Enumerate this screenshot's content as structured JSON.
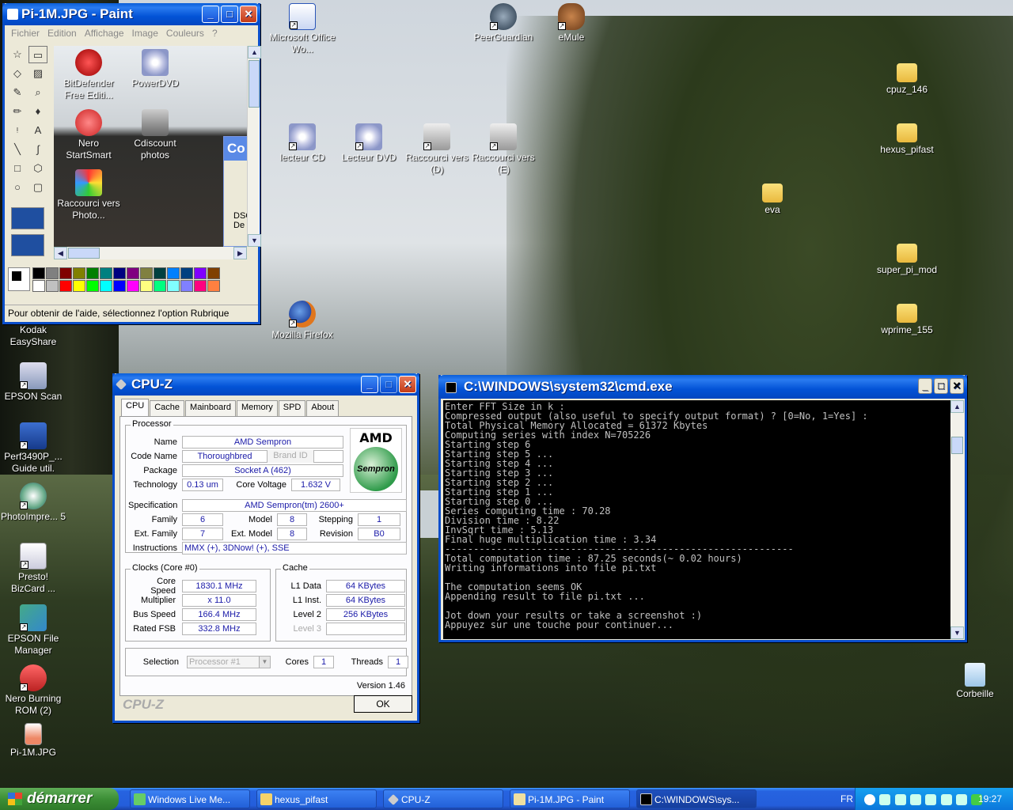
{
  "desktop": {
    "icons": [
      {
        "id": "msoffice",
        "label": "Microsoft Office Wo..."
      },
      {
        "id": "peerguardian",
        "label": "PeerGuardian"
      },
      {
        "id": "emule",
        "label": "eMule"
      },
      {
        "id": "lecteur_cd",
        "label": "lecteur CD"
      },
      {
        "id": "lecteur_dvd",
        "label": "Lecteur DVD"
      },
      {
        "id": "raccourci_d",
        "label": "Raccourci vers (D)"
      },
      {
        "id": "raccourci_e",
        "label": "Raccourci vers  (E)"
      },
      {
        "id": "cpuz146",
        "label": "cpuz_146"
      },
      {
        "id": "hexus",
        "label": "hexus_pifast"
      },
      {
        "id": "eva",
        "label": "eva"
      },
      {
        "id": "superpi",
        "label": "super_pi_mod"
      },
      {
        "id": "wprime",
        "label": "wprime_155"
      },
      {
        "id": "firefox",
        "label": "Mozilla Firefox"
      },
      {
        "id": "kodak",
        "label": "Kodak EasyShare"
      },
      {
        "id": "epsonscan",
        "label": "EPSON Scan"
      },
      {
        "id": "perf3490",
        "label": "Perf3490P_... Guide util."
      },
      {
        "id": "photoimpression",
        "label": "PhotoImpre... 5"
      },
      {
        "id": "presto",
        "label": "Presto! BizCard ..."
      },
      {
        "id": "epsonfile",
        "label": "EPSON File Manager"
      },
      {
        "id": "nero_burning",
        "label": "Nero Burning ROM (2)"
      },
      {
        "id": "pi1m",
        "label": "Pi-1M.JPG"
      },
      {
        "id": "corbeille",
        "label": "Corbeille"
      }
    ]
  },
  "paint": {
    "title": "Pi-1M.JPG - Paint",
    "menu": [
      "Fichier",
      "Edition",
      "Affichage",
      "Image",
      "Couleurs",
      "?"
    ],
    "canvas_icons": [
      {
        "label": "BitDefender Free Editi..."
      },
      {
        "label": "PowerDVD"
      },
      {
        "label": "Nero StartSmart"
      },
      {
        "label": "Cdiscount photos"
      },
      {
        "label": "Raccourci vers Photo..."
      }
    ],
    "canvas_fragment": [
      "Co",
      "DSC",
      "De"
    ],
    "tools": [
      "☆",
      "▭",
      "◇",
      "▨",
      "✎",
      "⌕",
      "✏",
      "♦",
      "ᵎ",
      "A",
      "╲",
      "∫",
      "□",
      "⬡",
      "○",
      "▢"
    ],
    "palette": [
      "#000000",
      "#808080",
      "#800000",
      "#808000",
      "#008000",
      "#008080",
      "#000080",
      "#800080",
      "#808040",
      "#004040",
      "#0080ff",
      "#004080",
      "#8000ff",
      "#804000",
      "#ffffff",
      "#c0c0c0",
      "#ff0000",
      "#ffff00",
      "#00ff00",
      "#00ffff",
      "#0000ff",
      "#ff00ff",
      "#ffff80",
      "#00ff80",
      "#80ffff",
      "#8080ff",
      "#ff0080",
      "#ff8040"
    ],
    "status": "Pour obtenir de l'aide, sélectionnez l'option Rubrique"
  },
  "cpuz": {
    "title": "CPU-Z",
    "tabs": [
      "CPU",
      "Cache",
      "Mainboard",
      "Memory",
      "SPD",
      "About"
    ],
    "processor": {
      "group": "Processor",
      "name_label": "Name",
      "name": "AMD Sempron",
      "codename_label": "Code Name",
      "codename": "Thoroughbred",
      "brandid_label": "Brand ID",
      "package_label": "Package",
      "package": "Socket A (462)",
      "technology_label": "Technology",
      "technology": "0.13 um",
      "voltage_label": "Core Voltage",
      "voltage": "1.632 V",
      "spec_label": "Specification",
      "spec": "AMD Sempron(tm)   2600+",
      "family_label": "Family",
      "family": "6",
      "model_label": "Model",
      "model": "8",
      "stepping_label": "Stepping",
      "stepping": "1",
      "extfamily_label": "Ext. Family",
      "extfamily": "7",
      "extmodel_label": "Ext. Model",
      "extmodel": "8",
      "revision_label": "Revision",
      "revision": "B0",
      "instructions_label": "Instructions",
      "instructions": "MMX (+), 3DNow! (+), SSE",
      "logo_brand": "AMD",
      "logo_product": "Sempron"
    },
    "clocks": {
      "group": "Clocks (Core #0)",
      "core_speed_label": "Core Speed",
      "core_speed": "1830.1 MHz",
      "multiplier_label": "Multiplier",
      "multiplier": "x 11.0",
      "bus_speed_label": "Bus Speed",
      "bus_speed": "166.4 MHz",
      "fsb_label": "Rated FSB",
      "fsb": "332.8 MHz"
    },
    "cache": {
      "group": "Cache",
      "l1d_label": "L1 Data",
      "l1d": "64 KBytes",
      "l1i_label": "L1 Inst.",
      "l1i": "64 KBytes",
      "l2_label": "Level 2",
      "l2": "256 KBytes",
      "l3_label": "Level 3"
    },
    "selection_label": "Selection",
    "selection": "Processor #1",
    "cores_label": "Cores",
    "cores": "1",
    "threads_label": "Threads",
    "threads": "1",
    "version": "Version 1.46",
    "brand": "CPU-Z",
    "ok": "OK"
  },
  "cmd": {
    "title": "C:\\WINDOWS\\system32\\cmd.exe",
    "lines": [
      "Enter FFT Size in k :",
      "Compressed output (also useful to specify output format) ? [0=No, 1=Yes] :",
      "Total Physical Memory Allocated = 61372 Kbytes",
      "Computing series with index N=705226",
      "Starting step 6",
      "Starting step 5 ...",
      "Starting step 4 ...",
      "Starting step 3 ...",
      "Starting step 2 ...",
      "Starting step 1 ...",
      "Starting step 0 ...",
      "Series computing time : 70.28",
      "Division time : 8.22",
      "InvSqrt time : 5.13",
      "Final huge multiplication time : 3.34",
      "-------------------------------------------------------------",
      "Total computation time : 87.25 seconds(~ 0.02 hours)",
      "Writing informations into file pi.txt",
      "",
      "The computation seems OK",
      "Appending result to file pi.txt ...",
      "",
      "Jot down your results or take a screenshot :)",
      "Appuyez sur une touche pour continuer..."
    ]
  },
  "taskbar": {
    "start": "démarrer",
    "items": [
      {
        "label": "Windows Live Me..."
      },
      {
        "label": "hexus_pifast"
      },
      {
        "label": "CPU-Z"
      },
      {
        "label": "Pi-1M.JPG - Paint"
      },
      {
        "label": "C:\\WINDOWS\\sys..."
      }
    ],
    "lang": "FR",
    "clock": "19:27"
  }
}
